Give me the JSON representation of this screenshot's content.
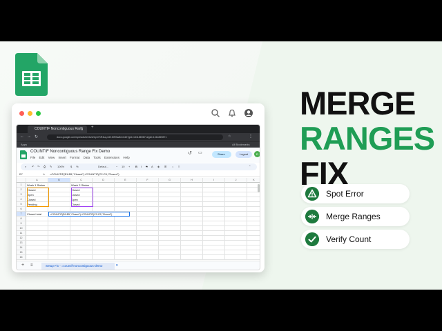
{
  "browser": {
    "tab_title": "COUNTIF Noncontiguous Rang",
    "url": "docs.google.com/spreadsheets/d/1ph7hR4uq-0Z1t5f9hw6m/edit?gid=1311869871#gid=1311869871",
    "bookmarks_left": "Apps",
    "bookmarks_right": "All Bookmarks"
  },
  "doc": {
    "title": "COUNTIF Noncontiguous Range Fix Demo",
    "menu": [
      "File",
      "Edit",
      "View",
      "Insert",
      "Format",
      "Data",
      "Tools",
      "Extensions",
      "Help"
    ],
    "share_label": "Share",
    "logout_label": "Logout",
    "avatar_letter": "D"
  },
  "toolbar": {
    "zoom": "100%",
    "currency": "$",
    "percent": "%",
    "font": "Defaul...",
    "font_size": "10"
  },
  "formula_bar": {
    "cell_ref": "B7",
    "fx": "fx",
    "formula": "=COUNTIF(B1:B5,\"Closed\")+COUNTIF(C2:C5,\"Closed\")"
  },
  "grid": {
    "columns": [
      "A",
      "B",
      "C",
      "D",
      "E",
      "F",
      "G",
      "H",
      "I",
      "J",
      "K"
    ],
    "rows": [
      "1",
      "2",
      "3",
      "4",
      "5",
      "6",
      "7",
      "8",
      "9",
      "10",
      "11",
      "12",
      "13",
      "14",
      "15",
      "16"
    ],
    "cells": {
      "a1": "Week 1 Status",
      "a2": "Closed",
      "a3": "Open",
      "a4": "Closed",
      "a5": "Pending",
      "c1": "Week 2 Status",
      "c2": "Closed",
      "c3": "Closed",
      "c4": "Open",
      "c5": "Closed",
      "a7": "Closed total",
      "b7": "=COUNTIF(B1:B5,\"Closed\")+COUNTIF(C2:C5,\"Closed\")"
    }
  },
  "sheet_tab": "Setup Fix - =countif-noncontiguous-demo",
  "headline": {
    "line1": "MERGE",
    "line2": "RANGES",
    "line3": "FIX"
  },
  "steps": [
    {
      "label": "Spot Error",
      "icon": "warning-icon"
    },
    {
      "label": "Merge Ranges",
      "icon": "merge-icon"
    },
    {
      "label": "Verify Count",
      "icon": "check-icon"
    }
  ],
  "colors": {
    "green": "#1f9d55",
    "dark_green": "#1e7a3e",
    "sheets_green": "#23a566"
  }
}
